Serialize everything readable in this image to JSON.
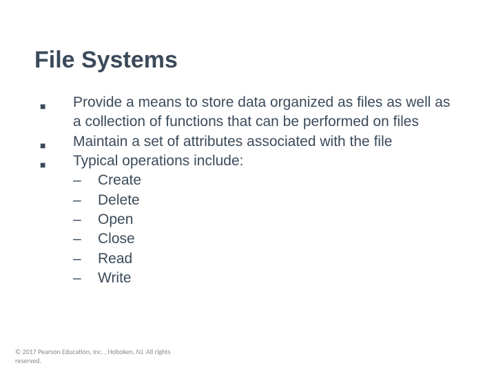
{
  "title": "File Systems",
  "bullets": [
    {
      "text": "Provide a means to store data organized as files as well as a collection of functions that can be performed on files"
    },
    {
      "text": "Maintain a set of attributes associated with the file"
    },
    {
      "text": "Typical operations include:"
    }
  ],
  "sublist": [
    "Create",
    "Delete",
    "Open",
    "Close",
    "Read",
    "Write"
  ],
  "footer": {
    "line1": "© 2017 Pearson Education, Inc. , Hoboken, NJ. All rights",
    "line2": "reserved."
  }
}
